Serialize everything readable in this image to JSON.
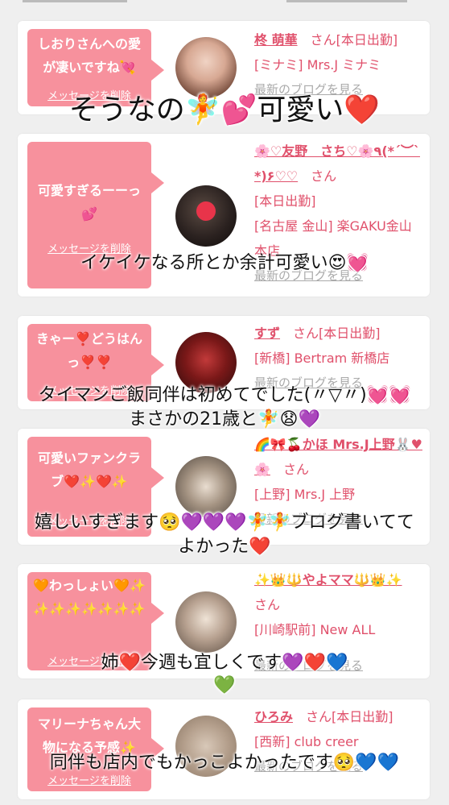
{
  "cards": [
    {
      "message": "しおりさんへの愛が凄いですね💘",
      "delete_label": "メッセージを削除",
      "name": "柊 萌華",
      "honorific": "さん[本日出勤]",
      "store": "[ミナミ] Mrs.J ミナミ",
      "blog_label": "最新のブログを見る"
    },
    {
      "message": "可愛すぎるーーっ💕",
      "delete_label": "メッセージを削除",
      "name": "🌸♡友野　さち♡🌸٩(*´︶`*)۶♡♡",
      "honorific": "さん",
      "status": "[本日出勤]",
      "store": "[名古屋 金山] 楽GAKU金山本店",
      "blog_label": "最新のブログを見る"
    },
    {
      "message": "きゃー❣️どうはんっ❣️❣️",
      "delete_label": "メッセージを削除",
      "name": "すず",
      "honorific": "さん[本日出勤]",
      "store": "[新橋] Bertram 新橋店",
      "blog_label": "最新のブログを見る"
    },
    {
      "message": "可愛いファンクラブ❤️✨❤️✨",
      "delete_label": "メッセージを削除",
      "name": "🌈🎀🍒かほ Mrs.J上野🐰♥🌸",
      "honorific": "さん",
      "store": "[上野] Mrs.J 上野",
      "blog_label": "最新のブログを見る"
    },
    {
      "message": "🧡わっしょい🧡✨✨✨✨✨✨✨✨",
      "delete_label": "メッセージを削除",
      "name": "✨👑🔱やよママ🔱👑✨",
      "honorific": "さん",
      "store": "[川崎駅前] New ALL",
      "blog_label": "最新のブログを見る"
    },
    {
      "message": "マリーナちゃん大物になる予感✨",
      "delete_label": "メッセージを削除",
      "name": "ひろみ",
      "honorific": "さん[本日出勤]",
      "store": "[西新] club creer",
      "blog_label": "最新のブログを見る"
    }
  ],
  "captions": [
    "そうなの🧚💕可愛い❤️",
    "イケイケなる所とか余計可愛い😍💓",
    "タイマンご飯同伴は初めてでした(〃▽〃)💓💓",
    "まさかの21歳と🧚😧💜",
    "嬉しいすぎます🥺💜💜💜🧚🧚ブログ書いてて",
    "よかった❤️",
    "姉❤️今週も宜しくです💜❤️💙",
    "💚",
    "同伴も店内でもかっこよかったです🥺💙💙"
  ],
  "colors": {
    "bubble": "#f7919d",
    "name_text": "#e0506b",
    "background": "#efefef"
  }
}
